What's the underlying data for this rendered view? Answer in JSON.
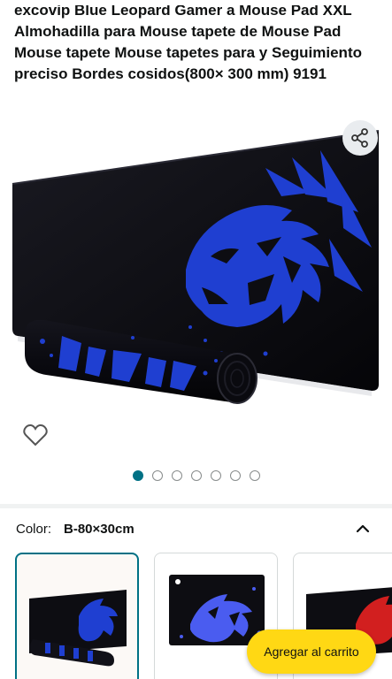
{
  "product": {
    "title": "excovip Blue Leopard Gamer a Mouse Pad XXL Almohadilla para Mouse tapete de Mouse Pad Mouse tapete Mouse tapetes para y Seguimiento preciso Bordes cosidos(800× 300 mm) 9191"
  },
  "gallery": {
    "image_count": 7,
    "active_index": 0,
    "share_icon": "share-icon",
    "favorite_icon": "heart-outline-icon"
  },
  "variation": {
    "label": "Color:",
    "selected_value": "B-80×30cm",
    "expand_icon": "chevron-up-icon",
    "swatches": [
      {
        "name": "blue-leopard-roll",
        "selected": true
      },
      {
        "name": "blue-leopard-square",
        "selected": false
      },
      {
        "name": "red-leopard",
        "selected": false
      }
    ]
  },
  "actions": {
    "add_to_cart": "Agregar al carrito"
  },
  "colors": {
    "accent": "#007185",
    "cart_button": "#ffd814",
    "pad_blue": "#1f3fd1",
    "pad_black": "#0d0d12"
  }
}
